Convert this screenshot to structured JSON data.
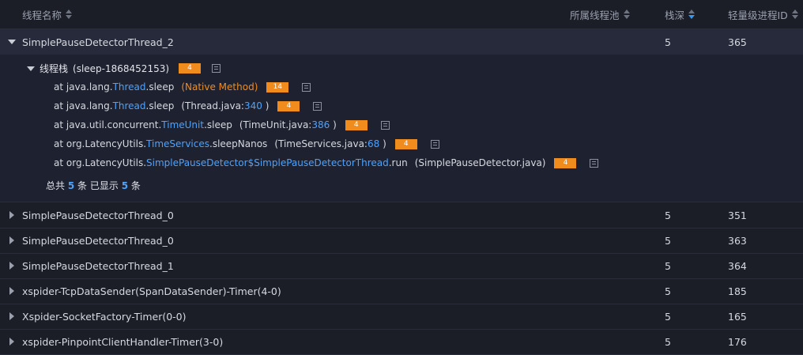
{
  "header": {
    "thread_name": "线程名称",
    "thread_pool": "所属线程池",
    "stack_depth": "栈深",
    "lwp_id": "轻量级进程ID"
  },
  "expanded_row": {
    "name": "SimplePauseDetectorThread_2",
    "depth": "5",
    "lwp": "365"
  },
  "stack": {
    "label": "线程栈",
    "id": "(sleep-1868452153)",
    "badge": "4",
    "frames": [
      {
        "prefix": "at java.lang.",
        "cls": "Thread",
        "method": ".sleep",
        "src_prefix": "(",
        "src_file": "Native Method",
        "src_line": "",
        "src_suffix": ")",
        "badge": "14",
        "native": true
      },
      {
        "prefix": "at java.lang.",
        "cls": "Thread",
        "method": ".sleep",
        "src_prefix": "(Thread.java:",
        "src_file": "",
        "src_line": "340",
        "src_suffix": " )",
        "badge": "4"
      },
      {
        "prefix": "at java.util.concurrent.",
        "cls": "TimeUnit",
        "method": ".sleep",
        "src_prefix": "(TimeUnit.java:",
        "src_file": "",
        "src_line": "386",
        "src_suffix": " )",
        "badge": "4"
      },
      {
        "prefix": "at org.LatencyUtils.",
        "cls": "TimeServices",
        "method": ".sleepNanos",
        "src_prefix": "(TimeServices.java:",
        "src_file": "",
        "src_line": "68",
        "src_suffix": " )",
        "badge": "4"
      },
      {
        "prefix": "at org.LatencyUtils.",
        "cls": "SimplePauseDetector$SimplePauseDetectorThread",
        "method": ".run",
        "src_prefix": "(SimplePauseDetector.java)",
        "src_file": "",
        "src_line": "",
        "src_suffix": "",
        "badge": "4"
      }
    ],
    "total_prefix": "总共",
    "total_count": "5",
    "total_mid": "条 已显示",
    "shown_count": "5",
    "total_suffix": "条"
  },
  "rows": [
    {
      "name": "SimplePauseDetectorThread_0",
      "depth": "5",
      "lwp": "351"
    },
    {
      "name": "SimplePauseDetectorThread_0",
      "depth": "5",
      "lwp": "363"
    },
    {
      "name": "SimplePauseDetectorThread_1",
      "depth": "5",
      "lwp": "364"
    },
    {
      "name": "xspider-TcpDataSender(SpanDataSender)-Timer(4-0)",
      "depth": "5",
      "lwp": "185"
    },
    {
      "name": "Xspider-SocketFactory-Timer(0-0)",
      "depth": "5",
      "lwp": "165"
    },
    {
      "name": "xspider-PinpointClientHandler-Timer(3-0)",
      "depth": "5",
      "lwp": "176"
    }
  ],
  "colors": {
    "bg": "#1b1d27",
    "accent": "#4aa3ff",
    "badge": "#f08c1e",
    "expanded_bg": "#262a3a"
  }
}
